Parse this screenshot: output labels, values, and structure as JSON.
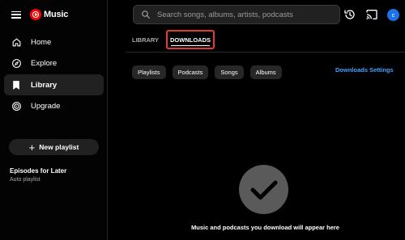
{
  "app": {
    "name": "Music"
  },
  "nav": [
    {
      "label": "Home",
      "icon": "home-icon",
      "active": false
    },
    {
      "label": "Explore",
      "icon": "explore-icon",
      "active": false
    },
    {
      "label": "Library",
      "icon": "library-icon",
      "active": true
    },
    {
      "label": "Upgrade",
      "icon": "upgrade-icon",
      "active": false
    }
  ],
  "sidebar": {
    "new_playlist_label": "New playlist",
    "playlist": {
      "title": "Episodes for Later",
      "subtitle": "Auto playlist"
    }
  },
  "search": {
    "placeholder": "Search songs, albums, artists, podcasts"
  },
  "account": {
    "avatar_initial": "c",
    "avatar_color": "#1a73e8"
  },
  "tabs": [
    {
      "label": "LIBRARY",
      "active": false
    },
    {
      "label": "DOWNLOADS",
      "active": true
    }
  ],
  "chips": [
    "Playlists",
    "Podcasts",
    "Songs",
    "Albums"
  ],
  "downloads_settings_label": "Downloads Settings",
  "empty_state": {
    "message": "Music and podcasts you download will appear here",
    "icon": "checkmark-icon"
  },
  "colors": {
    "accent_red": "#ff0000",
    "highlight_border": "#e53935",
    "link_blue": "#3ea6ff"
  }
}
